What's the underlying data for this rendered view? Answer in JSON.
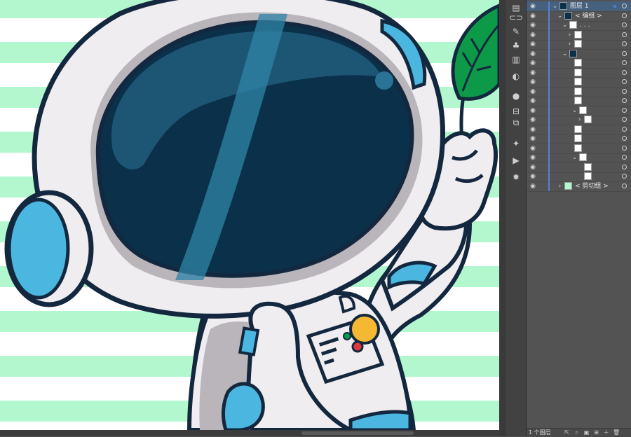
{
  "canvas": {
    "stripe_color": "#b3f7cf",
    "helmet_glass": "#0b3049",
    "helmet_glass_light": "#1d5674",
    "suit_white": "#efedf0",
    "suit_shade": "#b9b5ba",
    "accent_blue": "#4bb7e0",
    "outline": "#13283f",
    "leaf_green": "#0d9a48",
    "badge_yellow": "#f5b833",
    "badge_red": "#e0383f"
  },
  "tools": [
    "layers-icon",
    "links-icon",
    "brush-icon",
    "symbol-icon",
    "gradient-icon",
    "transparency-icon",
    "appearance-icon",
    "align-icon",
    "pathfinder-icon",
    "magic-wand-icon",
    "play-icon",
    "gear-icon"
  ],
  "layers": {
    "rows": [
      {
        "name": "图层 1",
        "selected": true
      },
      {
        "name": "< 编组 >",
        "selected": false
      },
      {
        "name": ". . .",
        "selected": false
      },
      {
        "name": "",
        "selected": false
      },
      {
        "name": "",
        "selected": false
      },
      {
        "name": "",
        "selected": false
      },
      {
        "name": "",
        "selected": false
      },
      {
        "name": "",
        "selected": false
      },
      {
        "name": "",
        "selected": false
      },
      {
        "name": "",
        "selected": false
      },
      {
        "name": "",
        "selected": false
      },
      {
        "name": "",
        "selected": false
      },
      {
        "name": "",
        "selected": false
      },
      {
        "name": "",
        "selected": false
      },
      {
        "name": "",
        "selected": false
      },
      {
        "name": "",
        "selected": false
      },
      {
        "name": "",
        "selected": false
      },
      {
        "name": "",
        "selected": false
      },
      {
        "name": "",
        "selected": false
      },
      {
        "name": "< 剪切组 >",
        "selected": false
      }
    ],
    "footer_count": "1 个图层"
  }
}
